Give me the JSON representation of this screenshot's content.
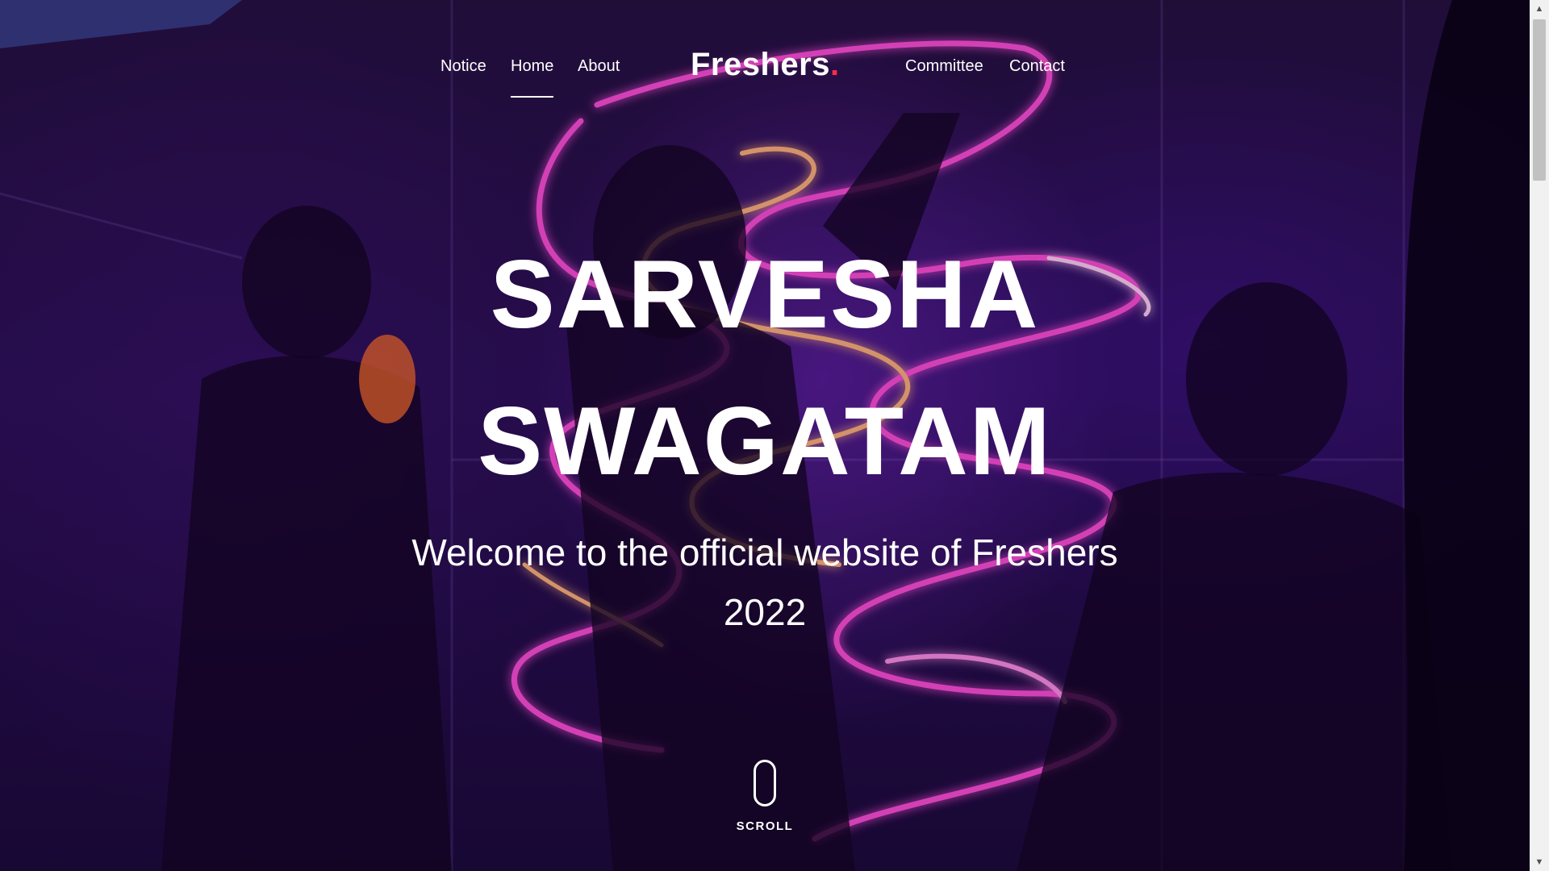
{
  "nav": {
    "left_links": [
      {
        "label": "Notice"
      },
      {
        "label": "Home",
        "active": true
      },
      {
        "label": "About"
      }
    ],
    "brand": {
      "text": "Freshers",
      "dot": "."
    },
    "right_links": [
      {
        "label": "Committee"
      },
      {
        "label": "Contact"
      }
    ]
  },
  "hero": {
    "title_line1": "SARVESHA",
    "title_line2": "SWAGATAM",
    "subtitle": "Welcome to the official website of Freshers 2022"
  },
  "scroll_indicator": {
    "label": "SCROLL",
    "icon": "mouse-icon"
  },
  "colors": {
    "accent_dot": "#ff2a4d",
    "neon_pink": "#ff4fd8",
    "neon_violet": "#c040ff",
    "text": "#ffffff"
  },
  "scrollbar": {
    "up_icon": "▲",
    "down_icon": "▼"
  }
}
